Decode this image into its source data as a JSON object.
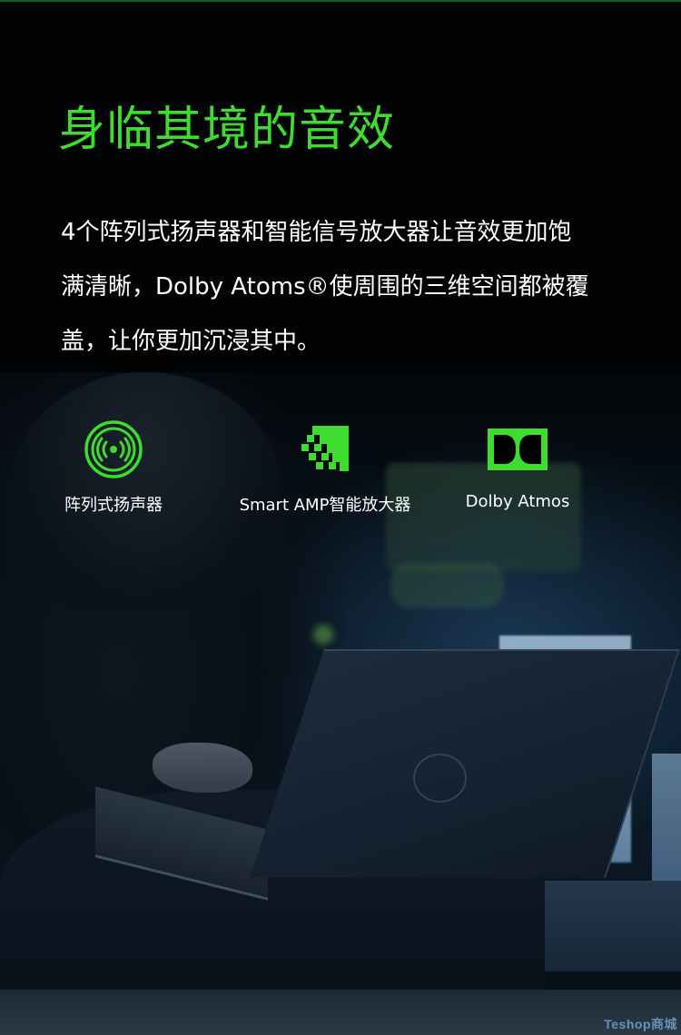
{
  "headline": "身临其境的音效",
  "body": {
    "line1": "4个阵列式扬声器和智能信号放大器让音效更加饱",
    "line2": "满清晰，Dolby Atoms®使周围的三维空间都被覆",
    "line3": "盖，让你更加沉浸其中。"
  },
  "features": [
    {
      "icon": "speaker-array-icon",
      "label": "阵列式扬声器"
    },
    {
      "icon": "smart-amp-icon",
      "label": "Smart AMP智能放大器"
    },
    {
      "icon": "dolby-logo-icon",
      "label": "Dolby Atmos"
    }
  ],
  "watermark": "Teshop商城",
  "colors": {
    "accent": "#3ddc2e",
    "background": "#020304",
    "text": "#ffffff"
  }
}
